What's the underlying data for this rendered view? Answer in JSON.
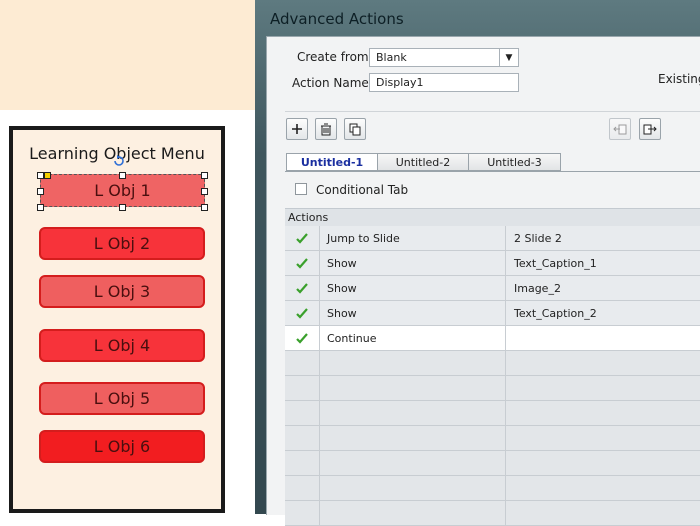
{
  "menu": {
    "title": "Learning Object Menu",
    "items": [
      {
        "label": "L Obj 1",
        "state": "selected"
      },
      {
        "label": "L Obj 2",
        "state": "normal"
      },
      {
        "label": "L Obj 3",
        "state": "normal"
      },
      {
        "label": "L Obj 4",
        "state": "normal"
      },
      {
        "label": "L Obj 5",
        "state": "normal"
      },
      {
        "label": "L Obj 6",
        "state": "normal"
      }
    ]
  },
  "dialog": {
    "title": "Advanced Actions",
    "create_from_label": "Create from:",
    "create_from_value": "Blank",
    "action_name_label": "Action Name:",
    "action_name_value": "Display1",
    "existing_label": "Existing",
    "toolbar_icons": [
      "add-icon",
      "delete-icon",
      "duplicate-icon",
      "move-left-icon",
      "move-right-icon"
    ],
    "tabs": [
      {
        "label": "Untitled-1",
        "active": true
      },
      {
        "label": "Untitled-2",
        "active": false
      },
      {
        "label": "Untitled-3",
        "active": false
      }
    ],
    "conditional_tab_label": "Conditional Tab",
    "conditional_tab_checked": false,
    "actions_header": "Actions",
    "actions": [
      {
        "action": "Jump to Slide",
        "target": "2 Slide 2",
        "checked": true
      },
      {
        "action": "Show",
        "target": "Text_Caption_1",
        "checked": true
      },
      {
        "action": "Show",
        "target": "Image_2",
        "checked": true
      },
      {
        "action": "Show",
        "target": "Text_Caption_2",
        "checked": true
      },
      {
        "action": "Continue",
        "target": "",
        "checked": true
      }
    ]
  },
  "colors": {
    "stage_bg": "#fdebd3",
    "button_red": "#f7333a",
    "button_pale_red": "#ef5f5f",
    "check_green": "#3aa02c",
    "active_tab_text": "#1a2fa0"
  }
}
